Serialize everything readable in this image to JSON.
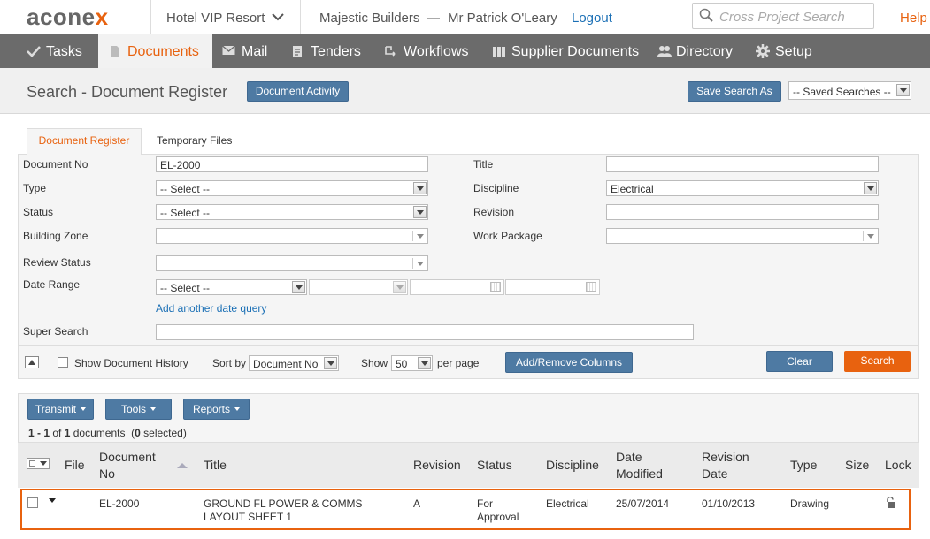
{
  "header": {
    "logo_prefix": "acone",
    "logo_suffix": "x",
    "project": "Hotel VIP Resort",
    "company": "Majestic Builders",
    "separator": "—",
    "user": "Mr Patrick O'Leary",
    "logout": "Logout",
    "search_placeholder": "Cross Project Search",
    "help": "Help"
  },
  "nav": {
    "tasks": "Tasks",
    "documents": "Documents",
    "mail": "Mail",
    "tenders": "Tenders",
    "workflows": "Workflows",
    "supplier_documents": "Supplier Documents",
    "directory": "Directory",
    "setup": "Setup"
  },
  "titlebar": {
    "title": "Search - Document Register",
    "document_activity": "Document Activity",
    "save_search_as": "Save Search As",
    "saved_searches": "-- Saved Searches --"
  },
  "tabs": {
    "document_register": "Document Register",
    "temporary_files": "Temporary Files"
  },
  "form": {
    "document_no_label": "Document No",
    "document_no_value": "EL-2000",
    "title_label": "Title",
    "title_value": "",
    "type_label": "Type",
    "type_value": "-- Select --",
    "discipline_label": "Discipline",
    "discipline_value": "Electrical",
    "status_label": "Status",
    "status_value": "-- Select --",
    "revision_label": "Revision",
    "building_zone_label": "Building Zone",
    "work_package_label": "Work Package",
    "review_status_label": "Review Status",
    "date_range_label": "Date Range",
    "date_range_value": "-- Select --",
    "add_date_query": "Add another date query",
    "super_search_label": "Super Search",
    "show_history": "Show Document History",
    "sort_by_label": "Sort by",
    "sort_by_value": "Document No",
    "show_label": "Show",
    "show_value": "50",
    "per_page": "per page",
    "add_remove_columns": "Add/Remove Columns",
    "clear": "Clear",
    "search": "Search"
  },
  "results": {
    "transmit": "Transmit",
    "tools": "Tools",
    "reports": "Reports",
    "count_range": "1 - 1",
    "count_of": "of",
    "count_total": "1",
    "count_docs": "documents",
    "count_selected_open": "(",
    "count_selected": "0",
    "count_selected_close": "selected)",
    "columns": {
      "file": "File",
      "document_no": "Document No",
      "title": "Title",
      "revision": "Revision",
      "status": "Status",
      "discipline": "Discipline",
      "date_modified": "Date Modified",
      "revision_date": "Revision Date",
      "type": "Type",
      "size": "Size",
      "lock": "Lock"
    },
    "rows": [
      {
        "document_no": "EL-2000",
        "title": "GROUND FL POWER & COMMS LAYOUT SHEET 1",
        "revision": "A",
        "status": "For Approval",
        "discipline": "Electrical",
        "date_modified": "25/07/2014",
        "revision_date": "01/10/2013",
        "type": "Drawing",
        "size": ""
      }
    ]
  },
  "colors": {
    "accent": "#e8620f",
    "nav_bg": "#6b6b6b",
    "button_blue": "#4e7aa3",
    "link": "#1a6fb5"
  }
}
